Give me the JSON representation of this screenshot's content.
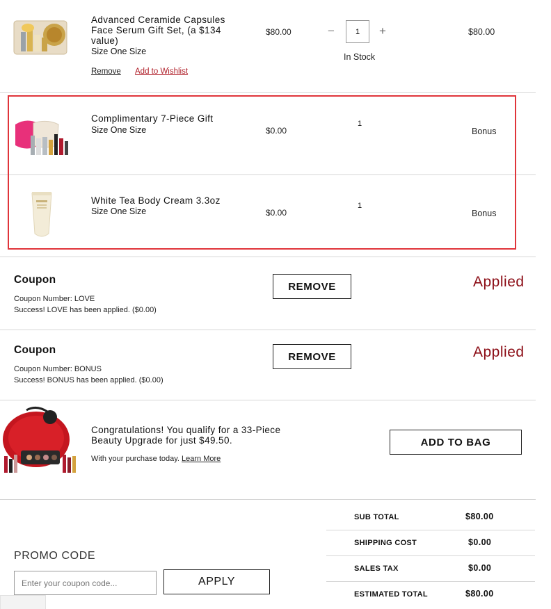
{
  "colors": {
    "accent": "#8b0b14",
    "highlight_border": "#e0343a",
    "wishlist_link": "#b0202a"
  },
  "items": [
    {
      "name": "Advanced Ceramide Capsules Face Serum Gift Set, (a $134 value)",
      "size": "Size One Size",
      "price": "$80.00",
      "quantity": "1",
      "stock": "In Stock",
      "total": "$80.00",
      "remove_label": "Remove",
      "wishlist_label": "Add to Wishlist",
      "minus": "−",
      "plus": "+"
    },
    {
      "name": "Complimentary 7-Piece Gift",
      "size": "Size One Size",
      "price": "$0.00",
      "quantity": "1",
      "total": "Bonus"
    },
    {
      "name": "White Tea Body Cream 3.3oz",
      "size": "Size One Size",
      "price": "$0.00",
      "quantity": "1",
      "total": "Bonus"
    }
  ],
  "coupons": [
    {
      "title": "Coupon",
      "number_line": "Coupon Number: LOVE",
      "status_line": "Success! LOVE has been applied. ($0.00)",
      "button": "REMOVE",
      "status": "Applied"
    },
    {
      "title": "Coupon",
      "number_line": "Coupon Number: BONUS",
      "status_line": "Success! BONUS has been applied. ($0.00)",
      "button": "REMOVE",
      "status": "Applied"
    }
  ],
  "upgrade": {
    "headline": "Congratulations! You qualify for a 33-Piece Beauty Upgrade for just $49.50.",
    "subtext": "With your purchase today.",
    "learn_more": "Learn More",
    "button": "ADD TO BAG"
  },
  "promo": {
    "label": "PROMO CODE",
    "placeholder": "Enter your coupon code...",
    "button": "APPLY"
  },
  "summary": [
    {
      "label": "SUB TOTAL",
      "value": "$80.00"
    },
    {
      "label": "SHIPPING COST",
      "value": "$0.00"
    },
    {
      "label": "SALES TAX",
      "value": "$0.00"
    },
    {
      "label": "ESTIMATED TOTAL",
      "value": "$80.00"
    }
  ]
}
